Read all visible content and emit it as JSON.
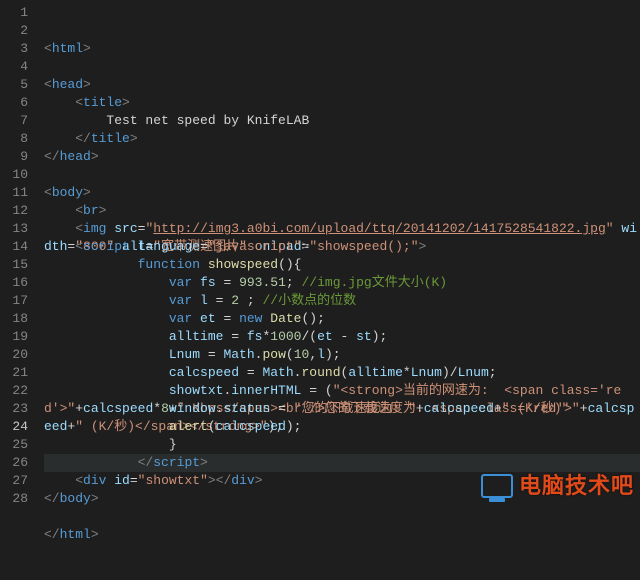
{
  "active_line": 24,
  "watermark": {
    "text": "电脑技术吧"
  },
  "gutter": [
    "1",
    "2",
    "3",
    "4",
    "5",
    "6",
    "7",
    "8",
    "9",
    "10",
    "11",
    "12",
    "13",
    "14",
    "15",
    "16",
    "17",
    "18",
    "19",
    "20",
    "21",
    "22",
    "23",
    "24",
    "25",
    "26",
    "27",
    "28"
  ],
  "code": {
    "lines": [
      {
        "n": 1,
        "tokens": [
          [
            "tag",
            "<"
          ],
          [
            "name",
            "html"
          ],
          [
            "tag",
            ">"
          ]
        ]
      },
      {
        "n": 2,
        "tokens": []
      },
      {
        "n": 3,
        "tokens": [
          [
            "tag",
            "<"
          ],
          [
            "name",
            "head"
          ],
          [
            "tag",
            ">"
          ]
        ]
      },
      {
        "n": 4,
        "tokens": [
          [
            "op",
            "    "
          ],
          [
            "tag",
            "<"
          ],
          [
            "name",
            "title"
          ],
          [
            "tag",
            ">"
          ]
        ]
      },
      {
        "n": 5,
        "tokens": [
          [
            "op",
            "        Test net speed by KnifeLAB"
          ]
        ]
      },
      {
        "n": 6,
        "tokens": [
          [
            "op",
            "    "
          ],
          [
            "tag",
            "</"
          ],
          [
            "name",
            "title"
          ],
          [
            "tag",
            ">"
          ]
        ]
      },
      {
        "n": 7,
        "tokens": [
          [
            "tag",
            "</"
          ],
          [
            "name",
            "head"
          ],
          [
            "tag",
            ">"
          ]
        ]
      },
      {
        "n": 8,
        "tokens": []
      },
      {
        "n": 9,
        "tokens": [
          [
            "tag",
            "<"
          ],
          [
            "name",
            "body"
          ],
          [
            "tag",
            ">"
          ]
        ]
      },
      {
        "n": 10,
        "tokens": [
          [
            "op",
            "    "
          ],
          [
            "tag",
            "<"
          ],
          [
            "name",
            "br"
          ],
          [
            "tag",
            ">"
          ]
        ]
      },
      {
        "n": 11,
        "tokens": [
          [
            "op",
            "    "
          ],
          [
            "tag",
            "<"
          ],
          [
            "name",
            "img"
          ],
          [
            "op",
            " "
          ],
          [
            "attr",
            "src"
          ],
          [
            "op",
            "="
          ],
          [
            "str",
            "\""
          ],
          [
            "link",
            "http://img3.a0bi.com/upload/ttq/20141202/1417528541822.jpg"
          ],
          [
            "str",
            "\""
          ],
          [
            "op",
            " "
          ],
          [
            "attr",
            "width"
          ],
          [
            "op",
            "="
          ],
          [
            "str",
            "\"800\""
          ],
          [
            "op",
            " "
          ],
          [
            "attr",
            "alt"
          ],
          [
            "op",
            "="
          ],
          [
            "str",
            "\"宽带测速图片\""
          ],
          [
            "op",
            " "
          ],
          [
            "attr",
            "onload"
          ],
          [
            "op",
            "="
          ],
          [
            "str",
            "\"showspeed();\""
          ],
          [
            "tag",
            ">"
          ]
        ]
      },
      {
        "n": 12,
        "tokens": [
          [
            "op",
            "    "
          ],
          [
            "tag",
            "<"
          ],
          [
            "name",
            "script"
          ],
          [
            "op",
            " "
          ],
          [
            "attr",
            "language"
          ],
          [
            "op",
            "="
          ],
          [
            "str",
            "\"javascript\""
          ],
          [
            "tag",
            ">"
          ]
        ]
      },
      {
        "n": 13,
        "tokens": [
          [
            "op",
            "            "
          ],
          [
            "kw",
            "function"
          ],
          [
            "op",
            " "
          ],
          [
            "fn",
            "showspeed"
          ],
          [
            "op",
            "(){"
          ]
        ]
      },
      {
        "n": 14,
        "tokens": [
          [
            "op",
            "                "
          ],
          [
            "kw",
            "var"
          ],
          [
            "op",
            " "
          ],
          [
            "var",
            "fs"
          ],
          [
            "op",
            " = "
          ],
          [
            "num",
            "993.51"
          ],
          [
            "op",
            "; "
          ],
          [
            "com",
            "//img.jpg文件大小(K)"
          ]
        ]
      },
      {
        "n": 15,
        "tokens": [
          [
            "op",
            "                "
          ],
          [
            "kw",
            "var"
          ],
          [
            "op",
            " "
          ],
          [
            "var",
            "l"
          ],
          [
            "op",
            " = "
          ],
          [
            "num",
            "2"
          ],
          [
            "op",
            " ; "
          ],
          [
            "com",
            "//小数点的位数"
          ]
        ]
      },
      {
        "n": 16,
        "tokens": [
          [
            "op",
            "                "
          ],
          [
            "kw",
            "var"
          ],
          [
            "op",
            " "
          ],
          [
            "var",
            "et"
          ],
          [
            "op",
            " = "
          ],
          [
            "kw",
            "new"
          ],
          [
            "op",
            " "
          ],
          [
            "fn",
            "Date"
          ],
          [
            "op",
            "();"
          ]
        ]
      },
      {
        "n": 17,
        "tokens": [
          [
            "op",
            "                "
          ],
          [
            "var",
            "alltime"
          ],
          [
            "op",
            " = "
          ],
          [
            "var",
            "fs"
          ],
          [
            "op",
            "*"
          ],
          [
            "num",
            "1000"
          ],
          [
            "op",
            "/("
          ],
          [
            "var",
            "et"
          ],
          [
            "op",
            " - "
          ],
          [
            "var",
            "st"
          ],
          [
            "op",
            ");"
          ]
        ]
      },
      {
        "n": 18,
        "tokens": [
          [
            "op",
            "                "
          ],
          [
            "var",
            "Lnum"
          ],
          [
            "op",
            " = "
          ],
          [
            "var",
            "Math"
          ],
          [
            "op",
            "."
          ],
          [
            "fn",
            "pow"
          ],
          [
            "op",
            "("
          ],
          [
            "num",
            "10"
          ],
          [
            "op",
            ","
          ],
          [
            "var",
            "l"
          ],
          [
            "op",
            ");"
          ]
        ]
      },
      {
        "n": 19,
        "tokens": [
          [
            "op",
            "                "
          ],
          [
            "var",
            "calcspeed"
          ],
          [
            "op",
            " = "
          ],
          [
            "var",
            "Math"
          ],
          [
            "op",
            "."
          ],
          [
            "fn",
            "round"
          ],
          [
            "op",
            "("
          ],
          [
            "var",
            "alltime"
          ],
          [
            "op",
            "*"
          ],
          [
            "var",
            "Lnum"
          ],
          [
            "op",
            ")/"
          ],
          [
            "var",
            "Lnum"
          ],
          [
            "op",
            ";"
          ]
        ]
      },
      {
        "n": 20,
        "tokens": [
          [
            "op",
            "                "
          ],
          [
            "var",
            "showtxt"
          ],
          [
            "op",
            "."
          ],
          [
            "var",
            "innerHTML"
          ],
          [
            "op",
            " = ("
          ],
          [
            "str",
            "\"<strong>当前的网速为:  <span class='red'>\""
          ],
          [
            "op",
            "+"
          ],
          [
            "var",
            "calcspeed"
          ],
          [
            "op",
            "*"
          ],
          [
            "num",
            "8"
          ],
          [
            "op",
            "+"
          ],
          [
            "str",
            "\" Kbps</span><br />您的下载速度为: <span class='red'>\""
          ],
          [
            "op",
            "+"
          ],
          [
            "var",
            "calcspeed"
          ],
          [
            "op",
            "+"
          ],
          [
            "str",
            "\" (K/秒)</span></strong>\""
          ],
          [
            "op",
            ");"
          ]
        ]
      },
      {
        "n": 21,
        "tokens": [
          [
            "op",
            "                "
          ],
          [
            "var",
            "window"
          ],
          [
            "op",
            "."
          ],
          [
            "var",
            "status"
          ],
          [
            "op",
            " = "
          ],
          [
            "str",
            "\"您的下载速度为: \""
          ],
          [
            "op",
            "+"
          ],
          [
            "var",
            "calcspeed"
          ],
          [
            "op",
            "+"
          ],
          [
            "str",
            "\" (K/秒)\""
          ]
        ]
      },
      {
        "n": 22,
        "tokens": [
          [
            "op",
            "                "
          ],
          [
            "fn",
            "alert"
          ],
          [
            "op",
            "("
          ],
          [
            "var",
            "calcspeed"
          ],
          [
            "op",
            ");"
          ]
        ]
      },
      {
        "n": 23,
        "tokens": [
          [
            "op",
            "                }"
          ]
        ]
      },
      {
        "n": 24,
        "tokens": [
          [
            "op",
            "            "
          ],
          [
            "tag",
            "</"
          ],
          [
            "name",
            "script"
          ],
          [
            "tag",
            ">"
          ]
        ]
      },
      {
        "n": 25,
        "tokens": [
          [
            "op",
            "    "
          ],
          [
            "tag",
            "<"
          ],
          [
            "name",
            "div"
          ],
          [
            "op",
            " "
          ],
          [
            "attr",
            "id"
          ],
          [
            "op",
            "="
          ],
          [
            "str",
            "\"showtxt\""
          ],
          [
            "tag",
            "></"
          ],
          [
            "name",
            "div"
          ],
          [
            "tag",
            ">"
          ]
        ]
      },
      {
        "n": 26,
        "tokens": [
          [
            "tag",
            "</"
          ],
          [
            "name",
            "body"
          ],
          [
            "tag",
            ">"
          ]
        ]
      },
      {
        "n": 27,
        "tokens": []
      },
      {
        "n": 28,
        "tokens": [
          [
            "tag",
            "</"
          ],
          [
            "name",
            "html"
          ],
          [
            "tag",
            ">"
          ]
        ]
      }
    ]
  }
}
